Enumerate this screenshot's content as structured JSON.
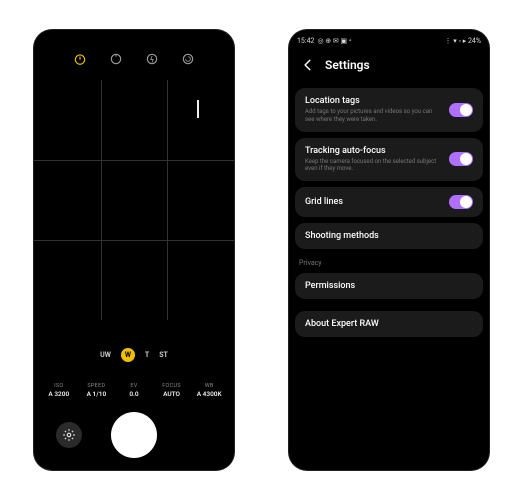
{
  "camera": {
    "top_icons": [
      "timer-icon",
      "aspect-icon",
      "flash-icon",
      "motion-icon"
    ],
    "zoom": {
      "items": [
        "UW",
        "W",
        "T",
        "ST"
      ],
      "active_index": 1
    },
    "params": [
      {
        "label": "ISO",
        "value": "A 3200"
      },
      {
        "label": "SPEED",
        "value": "A 1/10"
      },
      {
        "label": "EV",
        "value": "0.0"
      },
      {
        "label": "FOCUS",
        "value": "AUTO"
      },
      {
        "label": "WB",
        "value": "A 4300K"
      }
    ]
  },
  "settings": {
    "status": {
      "time": "15:42",
      "left_icons": "◎ ⊕ ✉ ▣ •",
      "right_icons": "⋮ ▾ ◦ ▸  24%"
    },
    "header": {
      "title": "Settings"
    },
    "items": {
      "location": {
        "title": "Location tags",
        "sub": "Add tags to your pictures and videos so you can see where they were taken."
      },
      "tracking": {
        "title": "Tracking auto-focus",
        "sub": "Keep the camera focused on the selected subject even if they move."
      },
      "gridlines": {
        "title": "Grid lines"
      },
      "shooting": {
        "title": "Shooting methods"
      },
      "privacy_label": "Privacy",
      "permissions": {
        "title": "Permissions"
      },
      "about": {
        "title": "About Expert RAW"
      }
    }
  }
}
